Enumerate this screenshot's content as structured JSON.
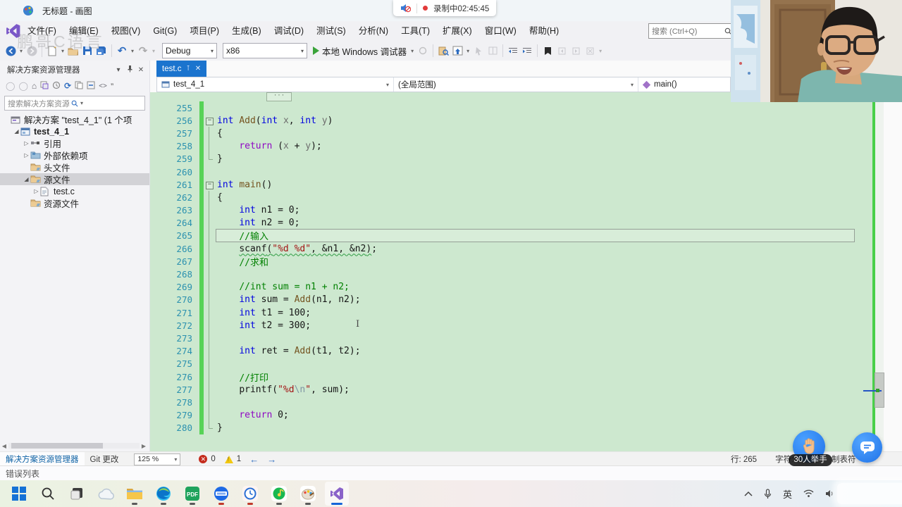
{
  "paint": {
    "title": "无标题 - 画图"
  },
  "recording": {
    "label": "录制中02:45:45"
  },
  "watermark": "鹏哥C语言",
  "menu": {
    "items": [
      "文件(F)",
      "编辑(E)",
      "视图(V)",
      "Git(G)",
      "项目(P)",
      "生成(B)",
      "调试(D)",
      "测试(S)",
      "分析(N)",
      "工具(T)",
      "扩展(X)",
      "窗口(W)",
      "帮助(H)"
    ],
    "search_placeholder": "搜索 (Ctrl+Q)"
  },
  "toolbar": {
    "config": "Debug",
    "platform": "x86",
    "run_label": "本地 Windows 调试器"
  },
  "solution_explorer": {
    "title": "解决方案资源管理器",
    "search_placeholder": "搜索解决方案资源管理器(Ct",
    "tree": [
      {
        "label": "解决方案 \"test_4_1\" (1 个项",
        "icon": "solution-icon",
        "depth": 0,
        "arrow": "",
        "bold": false,
        "selected": false
      },
      {
        "label": "test_4_1",
        "icon": "project-icon",
        "depth": 1,
        "arrow": "open",
        "bold": true,
        "selected": false
      },
      {
        "label": "引用",
        "icon": "references-icon",
        "depth": 2,
        "arrow": "closed",
        "bold": false,
        "selected": false
      },
      {
        "label": "外部依赖项",
        "icon": "folder-deps-icon",
        "depth": 2,
        "arrow": "closed",
        "bold": false,
        "selected": false
      },
      {
        "label": "头文件",
        "icon": "folder-icon",
        "depth": 2,
        "arrow": "",
        "bold": false,
        "selected": false
      },
      {
        "label": "源文件",
        "icon": "folder-icon",
        "depth": 2,
        "arrow": "open",
        "bold": false,
        "selected": true
      },
      {
        "label": "test.c",
        "icon": "c-file-icon",
        "depth": 3,
        "arrow": "closed",
        "bold": false,
        "selected": false
      },
      {
        "label": "资源文件",
        "icon": "folder-icon",
        "depth": 2,
        "arrow": "",
        "bold": false,
        "selected": false
      }
    ],
    "bottom_tabs": [
      "解决方案资源管理器",
      "Git 更改"
    ]
  },
  "editor": {
    "tab_label": "test.c",
    "breadcrumb": {
      "project": "test_4_1",
      "scope": "(全局范围)",
      "member": "main()"
    },
    "zoom": "125 %",
    "error_count": "0",
    "warning_count": "1",
    "status": {
      "line": "行: 265",
      "char": "字符: 6",
      "tabs": "制表符"
    },
    "code": {
      "lines": [
        {
          "n": "255",
          "fold": "",
          "cur": false,
          "toks": []
        },
        {
          "n": "256",
          "fold": "box",
          "cur": false,
          "toks": [
            [
              "k",
              "int"
            ],
            [
              "d",
              " "
            ],
            [
              "f",
              "Add"
            ],
            [
              "d",
              "("
            ],
            [
              "k",
              "int"
            ],
            [
              "d",
              " "
            ],
            [
              "p",
              "x"
            ],
            [
              "d",
              ", "
            ],
            [
              "k",
              "int"
            ],
            [
              "d",
              " "
            ],
            [
              "p",
              "y"
            ],
            [
              "d",
              ")"
            ]
          ]
        },
        {
          "n": "257",
          "fold": "line",
          "cur": false,
          "toks": [
            [
              "d",
              "{"
            ]
          ]
        },
        {
          "n": "258",
          "fold": "line",
          "cur": false,
          "toks": [
            [
              "d",
              "    "
            ],
            [
              "r",
              "return"
            ],
            [
              "d",
              " ("
            ],
            [
              "p",
              "x"
            ],
            [
              "d",
              " + "
            ],
            [
              "p",
              "y"
            ],
            [
              "d",
              ");"
            ]
          ]
        },
        {
          "n": "259",
          "fold": "end",
          "cur": false,
          "toks": [
            [
              "d",
              "}"
            ]
          ]
        },
        {
          "n": "260",
          "fold": "",
          "cur": false,
          "toks": []
        },
        {
          "n": "261",
          "fold": "box",
          "cur": false,
          "toks": [
            [
              "k",
              "int"
            ],
            [
              "d",
              " "
            ],
            [
              "f",
              "main"
            ],
            [
              "d",
              "()"
            ]
          ]
        },
        {
          "n": "262",
          "fold": "line",
          "cur": false,
          "toks": [
            [
              "d",
              "{"
            ]
          ]
        },
        {
          "n": "263",
          "fold": "line",
          "cur": false,
          "toks": [
            [
              "d",
              "    "
            ],
            [
              "k",
              "int"
            ],
            [
              "d",
              " n1 = 0;"
            ]
          ]
        },
        {
          "n": "264",
          "fold": "line",
          "cur": false,
          "toks": [
            [
              "d",
              "    "
            ],
            [
              "k",
              "int"
            ],
            [
              "d",
              " n2 = 0;"
            ]
          ]
        },
        {
          "n": "265",
          "fold": "line",
          "cur": true,
          "toks": [
            [
              "d",
              "    "
            ],
            [
              "c",
              "//输入"
            ]
          ]
        },
        {
          "n": "266",
          "fold": "line",
          "cur": false,
          "toks": [
            [
              "d",
              "    "
            ],
            [
              "d u",
              "scanf"
            ],
            [
              "d u",
              "("
            ],
            [
              "s u",
              "\"%d %d\""
            ],
            [
              "d u",
              ", &n1, &n2"
            ],
            [
              "d u",
              ")"
            ],
            [
              "d",
              ";"
            ]
          ]
        },
        {
          "n": "267",
          "fold": "line",
          "cur": false,
          "toks": [
            [
              "d",
              "    "
            ],
            [
              "c",
              "//求和"
            ]
          ]
        },
        {
          "n": "268",
          "fold": "line",
          "cur": false,
          "toks": []
        },
        {
          "n": "269",
          "fold": "line",
          "cur": false,
          "toks": [
            [
              "d",
              "    "
            ],
            [
              "c",
              "//int sum = n1 + n2;"
            ]
          ]
        },
        {
          "n": "270",
          "fold": "line",
          "cur": false,
          "toks": [
            [
              "d",
              "    "
            ],
            [
              "k",
              "int"
            ],
            [
              "d",
              " sum = "
            ],
            [
              "f",
              "Add"
            ],
            [
              "d",
              "(n1, n2);"
            ]
          ]
        },
        {
          "n": "271",
          "fold": "line",
          "cur": false,
          "toks": [
            [
              "d",
              "    "
            ],
            [
              "k",
              "int"
            ],
            [
              "d",
              " t1 = 100;"
            ]
          ]
        },
        {
          "n": "272",
          "fold": "line",
          "cur": false,
          "toks": [
            [
              "d",
              "    "
            ],
            [
              "k",
              "int"
            ],
            [
              "d",
              " t2 = 300;"
            ]
          ]
        },
        {
          "n": "273",
          "fold": "line",
          "cur": false,
          "toks": []
        },
        {
          "n": "274",
          "fold": "line",
          "cur": false,
          "toks": [
            [
              "d",
              "    "
            ],
            [
              "k",
              "int"
            ],
            [
              "d",
              " ret = "
            ],
            [
              "f",
              "Add"
            ],
            [
              "d",
              "(t1, t2);"
            ]
          ]
        },
        {
          "n": "275",
          "fold": "line",
          "cur": false,
          "toks": []
        },
        {
          "n": "276",
          "fold": "line",
          "cur": false,
          "toks": [
            [
              "d",
              "    "
            ],
            [
              "c",
              "//打印"
            ]
          ]
        },
        {
          "n": "277",
          "fold": "line",
          "cur": false,
          "toks": [
            [
              "d",
              "    "
            ],
            [
              "d",
              "printf"
            ],
            [
              "d",
              "("
            ],
            [
              "s",
              "\"%d"
            ],
            [
              "e",
              "\\n"
            ],
            [
              "s",
              "\""
            ],
            [
              "d",
              ", sum);"
            ]
          ]
        },
        {
          "n": "278",
          "fold": "line",
          "cur": false,
          "toks": []
        },
        {
          "n": "279",
          "fold": "line",
          "cur": false,
          "toks": [
            [
              "d",
              "    "
            ],
            [
              "r",
              "return"
            ],
            [
              "d",
              " 0;"
            ]
          ]
        },
        {
          "n": "280",
          "fold": "end",
          "cur": false,
          "toks": [
            [
              "d",
              "}"
            ]
          ]
        }
      ]
    }
  },
  "error_list_label": "错误列表",
  "overlay": {
    "hand_badge": "30人举手"
  },
  "taskbar": {
    "items": [
      {
        "name": "start",
        "running": false,
        "active": false,
        "ul": ""
      },
      {
        "name": "search",
        "running": false,
        "active": false,
        "ul": ""
      },
      {
        "name": "task-view",
        "running": false,
        "active": false,
        "ul": ""
      },
      {
        "name": "widgets-cloud",
        "running": false,
        "active": false,
        "ul": ""
      },
      {
        "name": "file-explorer",
        "running": true,
        "active": false,
        "ul": "dark"
      },
      {
        "name": "edge",
        "running": true,
        "active": false,
        "ul": "dark"
      },
      {
        "name": "pdf-reader",
        "running": true,
        "active": false,
        "ul": "dark"
      },
      {
        "name": "tencent-classroom",
        "running": true,
        "active": false,
        "ul": "red"
      },
      {
        "name": "clock-app",
        "running": true,
        "active": false,
        "ul": "red"
      },
      {
        "name": "qq-music",
        "running": true,
        "active": false,
        "ul": "dark"
      },
      {
        "name": "paint",
        "running": true,
        "active": false,
        "ul": "dark"
      },
      {
        "name": "visual-studio",
        "running": true,
        "active": true,
        "ul": "blue"
      }
    ],
    "tray_ime": "英"
  }
}
